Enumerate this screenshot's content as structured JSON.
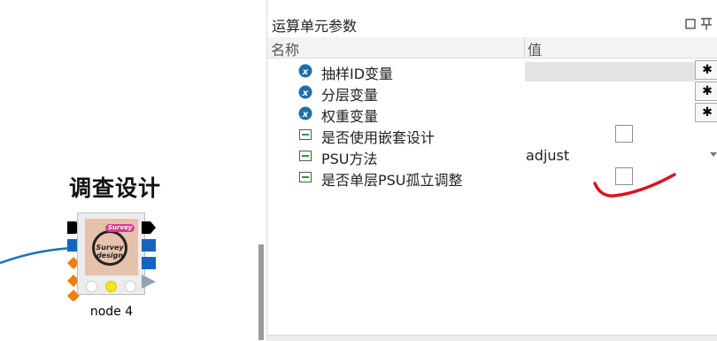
{
  "canvas": {
    "node": {
      "title": "调查设计",
      "badge": "Survey",
      "icon_line1": "Survey",
      "icon_line2": "design",
      "label": "node 4"
    }
  },
  "panel": {
    "title": "运算单元参数",
    "header": {
      "name": "名称",
      "value": "值"
    },
    "rows": [
      {
        "label": "抽样ID变量",
        "icon": "variable-x-icon",
        "value": ""
      },
      {
        "label": "分层变量",
        "icon": "variable-x-icon",
        "value": ""
      },
      {
        "label": "权重变量",
        "icon": "variable-x-icon",
        "value": ""
      },
      {
        "label": "是否使用嵌套设计",
        "icon": "boolean-param-icon",
        "value": false
      },
      {
        "label": "PSU方法",
        "icon": "boolean-param-icon",
        "value": "adjust"
      },
      {
        "label": "是否单层PSU孤立调整",
        "icon": "boolean-param-icon",
        "value": false
      }
    ],
    "gear_glyph": "✱"
  },
  "colors": {
    "connector": "#1f6fbf",
    "port_black": "#000000",
    "port_blue": "#1565c0",
    "port_orange": "#f07d10",
    "annotation_red": "#e0101a",
    "variable_icon": "#1e6fa8"
  }
}
